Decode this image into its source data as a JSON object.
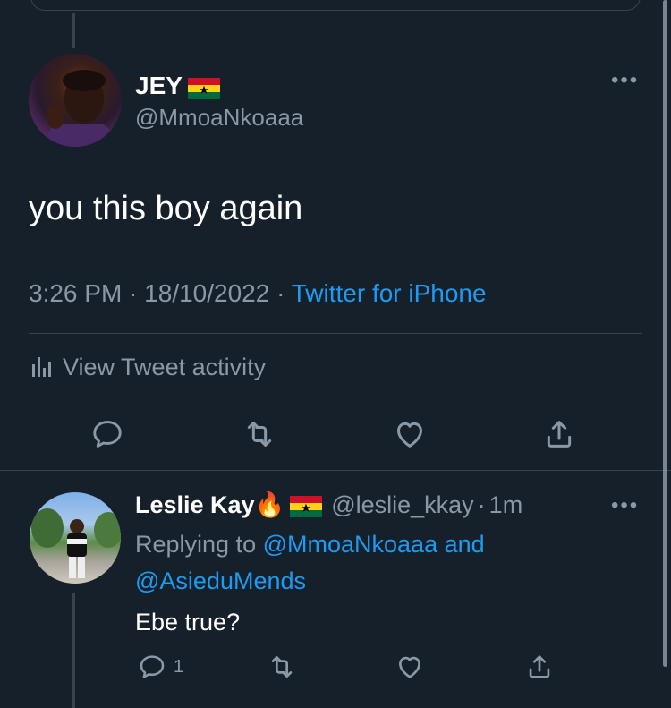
{
  "colors": {
    "background": "#15202b",
    "border": "#38444d",
    "muted": "#8b98a5",
    "link": "#1d9bf0"
  },
  "main_tweet": {
    "name": "JEY",
    "handle": "@MmoaNkoaaa",
    "text": "you this boy again",
    "time": "3:26 PM",
    "separator": " · ",
    "date": "18/10/2022",
    "source": "Twitter for iPhone",
    "activity_label": "View Tweet activity",
    "more_icon": "more-horizontal-icon"
  },
  "reply_tweet": {
    "name": "Leslie Kay",
    "emoji": "🔥",
    "handle": "@leslie_kkay",
    "age_separator": "·",
    "age": "1m",
    "replying_prefix": "Replying to ",
    "replying_user_1": "@MmoaNkoaaa",
    "replying_and": " and ",
    "replying_user_2": "@AsieduMends",
    "text": "Ebe true?",
    "reply_count": "1"
  },
  "actions": [
    "reply-icon",
    "retweet-icon",
    "like-icon",
    "share-icon"
  ]
}
